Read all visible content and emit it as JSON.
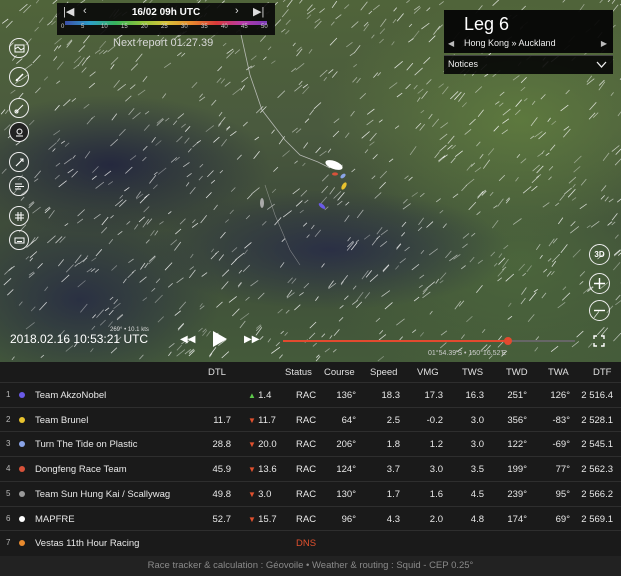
{
  "map": {
    "report_date": "16/02 09h UTC",
    "wind_scale_labels": [
      "0",
      "5",
      "10",
      "15",
      "20",
      "25",
      "30",
      "35",
      "40",
      "45",
      "50"
    ],
    "next_report": "Next report 01.27.39",
    "current_time": "2018.02.16 10:53:21 UTC",
    "wind_reading": "269° • 10.1 kts",
    "timeline_progress": 0.77,
    "cursor_coords": "01°54.39'S • 150°16.52'E"
  },
  "leg": {
    "title": "Leg 6",
    "route": "Hong Kong » Auckland",
    "notices_label": "Notices"
  },
  "right_controls": {
    "three_d_label": "3D"
  },
  "leaderboard": {
    "headers": {
      "dtl": "DTL",
      "status": "Status",
      "course": "Course",
      "speed": "Speed",
      "vmg": "VMG",
      "tws": "TWS",
      "twd": "TWD",
      "twa": "TWA",
      "dtf": "DTF"
    },
    "rows": [
      {
        "rank": "1",
        "color": "#6a5ae8",
        "name": "Team AkzoNobel",
        "dtl": "",
        "trend": "up",
        "change": "1.4",
        "status": "RAC",
        "course": "136°",
        "speed": "18.3",
        "vmg": "17.3",
        "tws": "16.3",
        "twd": "251°",
        "twa": "126°",
        "dtf": "2 516.4"
      },
      {
        "rank": "2",
        "color": "#e8c32e",
        "name": "Team Brunel",
        "dtl": "11.7",
        "trend": "down",
        "change": "11.7",
        "status": "RAC",
        "course": "64°",
        "speed": "2.5",
        "vmg": "-0.2",
        "tws": "3.0",
        "twd": "356°",
        "twa": "-83°",
        "dtf": "2 528.1"
      },
      {
        "rank": "3",
        "color": "#8aa4e8",
        "name": "Turn The Tide on Plastic",
        "dtl": "28.8",
        "trend": "down",
        "change": "20.0",
        "status": "RAC",
        "course": "206°",
        "speed": "1.8",
        "vmg": "1.2",
        "tws": "3.0",
        "twd": "122°",
        "twa": "-69°",
        "dtf": "2 545.1"
      },
      {
        "rank": "4",
        "color": "#d8523a",
        "name": "Dongfeng Race Team",
        "dtl": "45.9",
        "trend": "down",
        "change": "13.6",
        "status": "RAC",
        "course": "124°",
        "speed": "3.7",
        "vmg": "3.0",
        "tws": "3.5",
        "twd": "199°",
        "twa": "77°",
        "dtf": "2 562.3"
      },
      {
        "rank": "5",
        "color": "#9a9a9a",
        "name": "Team Sun Hung Kai / Scallywag",
        "dtl": "49.8",
        "trend": "down",
        "change": "3.0",
        "status": "RAC",
        "course": "130°",
        "speed": "1.7",
        "vmg": "1.6",
        "tws": "4.5",
        "twd": "239°",
        "twa": "95°",
        "dtf": "2 566.2"
      },
      {
        "rank": "6",
        "color": "#ffffff",
        "name": "MAPFRE",
        "dtl": "52.7",
        "trend": "down",
        "change": "15.7",
        "status": "RAC",
        "course": "96°",
        "speed": "4.3",
        "vmg": "2.0",
        "tws": "4.8",
        "twd": "174°",
        "twa": "69°",
        "dtf": "2 569.1"
      },
      {
        "rank": "7",
        "color": "#e88a2e",
        "name": "Vestas 11th Hour Racing",
        "dtl": "",
        "trend": "",
        "change": "",
        "status": "DNS",
        "course": "",
        "speed": "",
        "vmg": "",
        "tws": "",
        "twd": "",
        "twa": "",
        "dtf": ""
      }
    ],
    "footer": "Race tracker & calculation : Géovoile • Weather & routing : Squid - CEP 0.25°"
  }
}
